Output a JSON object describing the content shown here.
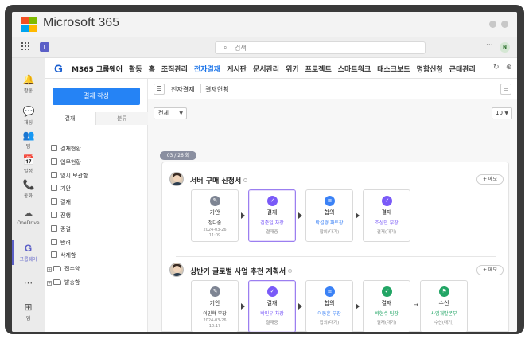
{
  "brand": {
    "title": "Microsoft 365",
    "logo_colors": [
      "#f25022",
      "#7fba00",
      "#00a4ef",
      "#ffb900"
    ]
  },
  "teams_bar": {
    "search_placeholder": "검색",
    "more": "···",
    "avatar_initial": "N"
  },
  "rail": [
    {
      "icon": "bell-icon",
      "glyph": "🔔",
      "label": "활동"
    },
    {
      "icon": "chat-icon",
      "glyph": "💬",
      "label": "채팅"
    },
    {
      "icon": "teams-icon",
      "glyph": "👥",
      "label": "팀"
    },
    {
      "icon": "calendar-icon",
      "glyph": "📅",
      "label": "일정"
    },
    {
      "icon": "phone-icon",
      "glyph": "📞",
      "label": "통화"
    },
    {
      "icon": "onedrive-icon",
      "glyph": "☁",
      "label": "OneDrive"
    },
    {
      "icon": "groupware-icon",
      "glyph": "G",
      "label": "그룹웨어"
    },
    {
      "icon": "more-icon",
      "glyph": "···",
      "label": ""
    },
    {
      "icon": "apps-icon",
      "glyph": "⊞",
      "label": "앱"
    }
  ],
  "app_header": {
    "logo": "G",
    "name": "M365 그룹웨어",
    "nav": [
      "활동",
      "홈",
      "조직관리",
      "전자결재",
      "게시판",
      "문서관리",
      "위키",
      "프로젝트",
      "스마트워크",
      "태스크보드",
      "명함신청",
      "근태관리"
    ],
    "active_nav": "전자결재"
  },
  "sidebar": {
    "compose_label": "결재 작성",
    "tabs": [
      "결재",
      "분류"
    ],
    "items": [
      {
        "label": "결재현황",
        "type": "doc"
      },
      {
        "label": "업무현황",
        "type": "doc"
      },
      {
        "label": "임시 보관함",
        "type": "doc"
      },
      {
        "label": "기안",
        "type": "doc"
      },
      {
        "label": "결재",
        "type": "doc"
      },
      {
        "label": "진행",
        "type": "doc"
      },
      {
        "label": "종결",
        "type": "doc"
      },
      {
        "label": "반려",
        "type": "doc"
      },
      {
        "label": "삭제함",
        "type": "doc"
      },
      {
        "label": "접수함",
        "type": "folder"
      },
      {
        "label": "발송함",
        "type": "folder"
      }
    ]
  },
  "main": {
    "breadcrumb": [
      "전자결재",
      "결재현황"
    ],
    "filter_value": "전체",
    "page_size": "10",
    "date_label": "03 / 26 화",
    "memo_label": "+ 메모",
    "documents": [
      {
        "title": "서버 구매 신청서",
        "steps": [
          {
            "type": "기안",
            "name": "정다솜",
            "date": "2024-03-26\n11:09",
            "status": "",
            "state": "done",
            "color": "#7e8593"
          },
          {
            "type": "결재",
            "name": "김준일 차장",
            "date": "",
            "status": "결재중",
            "state": "current",
            "color": "#7a5af8"
          },
          {
            "type": "합의",
            "name": "박설경 파트장",
            "date": "",
            "status": "합의(대기)",
            "state": "wait",
            "color": "#3b82f6"
          },
          {
            "type": "결재",
            "name": "조상민 부장",
            "date": "",
            "status": "결재(대기)",
            "state": "wait",
            "color": "#7a5af8"
          }
        ]
      },
      {
        "title": "상반기 글로벌 사업 추천 계획서",
        "steps": [
          {
            "type": "기안",
            "name": "이민혁 부장",
            "date": "2024-03-26\n10:17",
            "status": "",
            "state": "done",
            "color": "#7e8593"
          },
          {
            "type": "결재",
            "name": "박민우 차장",
            "date": "",
            "status": "결재중",
            "state": "current",
            "color": "#7a5af8"
          },
          {
            "type": "합의",
            "name": "이동훈 부장",
            "date": "",
            "status": "합의(대기)",
            "state": "wait",
            "color": "#3b82f6"
          },
          {
            "type": "결재",
            "name": "박현수 팀장",
            "date": "",
            "status": "결재(대기)",
            "state": "wait",
            "color": "#22a565"
          },
          {
            "type": "수신",
            "name": "사업개발본부",
            "date": "",
            "status": "수신(대기)",
            "state": "wait",
            "color": "#22a565"
          }
        ]
      }
    ]
  }
}
